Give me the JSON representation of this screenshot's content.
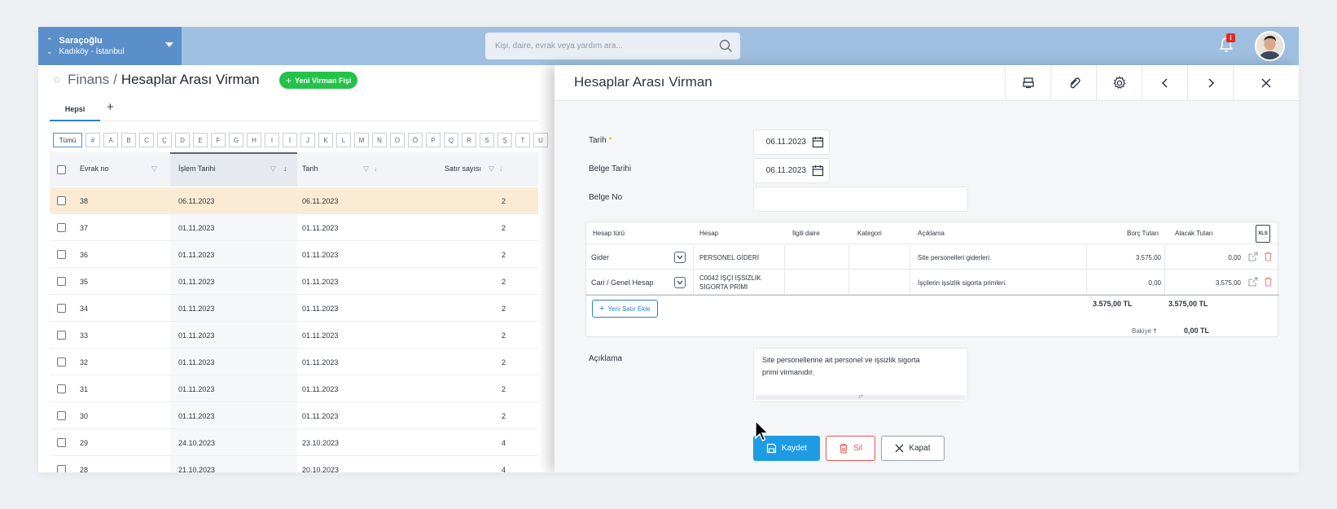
{
  "org": {
    "name": "Saraçoğlu",
    "location": "Kadıköy - İstanbul"
  },
  "search": {
    "placeholder": "Kişi, daire, evrak veya yardım ara..."
  },
  "notifications": {
    "badge": "i"
  },
  "breadcrumb": {
    "parent": "Finans",
    "separator": "/",
    "current": "Hesaplar Arası Virman"
  },
  "new_button": {
    "plus": "+",
    "label": "Yeni Virman Fişi"
  },
  "tabs": {
    "active": "Hepsi",
    "add": "+"
  },
  "letters": [
    "Tümü",
    "#",
    "A",
    "B",
    "C",
    "Ç",
    "D",
    "E",
    "F",
    "G",
    "H",
    "I",
    "İ",
    "J",
    "K",
    "L",
    "M",
    "N",
    "O",
    "Ö",
    "P",
    "Q",
    "R",
    "S",
    "Ş",
    "T",
    "U"
  ],
  "table": {
    "headers": {
      "evrak_no": "Evrak no",
      "islem_tarihi": "İşlem Tarihi",
      "tarih": "Tarih",
      "satir_sayisi": "Satır sayısı"
    },
    "rows": [
      {
        "no": "38",
        "islem": "06.11.2023",
        "tarih": "06.11.2023",
        "satir": "2",
        "selected": true
      },
      {
        "no": "37",
        "islem": "01.11.2023",
        "tarih": "01.11.2023",
        "satir": "2"
      },
      {
        "no": "36",
        "islem": "01.11.2023",
        "tarih": "01.11.2023",
        "satir": "2"
      },
      {
        "no": "35",
        "islem": "01.11.2023",
        "tarih": "01.11.2023",
        "satir": "2"
      },
      {
        "no": "34",
        "islem": "01.11.2023",
        "tarih": "01.11.2023",
        "satir": "2"
      },
      {
        "no": "33",
        "islem": "01.11.2023",
        "tarih": "01.11.2023",
        "satir": "2"
      },
      {
        "no": "32",
        "islem": "01.11.2023",
        "tarih": "01.11.2023",
        "satir": "2"
      },
      {
        "no": "31",
        "islem": "01.11.2023",
        "tarih": "01.11.2023",
        "satir": "2"
      },
      {
        "no": "30",
        "islem": "01.11.2023",
        "tarih": "01.11.2023",
        "satir": "2"
      },
      {
        "no": "29",
        "islem": "24.10.2023",
        "tarih": "23.10.2023",
        "satir": "4"
      },
      {
        "no": "28",
        "islem": "21.10.2023",
        "tarih": "20.10.2023",
        "satir": "4"
      }
    ]
  },
  "panel": {
    "title": "Hesaplar Arası Virman",
    "labels": {
      "tarih": "Tarih",
      "required": "*",
      "belge_tarihi": "Belge Tarihi",
      "belge_no": "Belge No",
      "aciklama": "Açıklama"
    },
    "values": {
      "tarih": "06.11.2023",
      "belge_tarihi": "06.11.2023",
      "belge_no": ""
    },
    "grid": {
      "headers": {
        "hesap_turu": "Hesap türü",
        "hesap": "Hesap",
        "ilgili_daire": "İlgili daire",
        "kategori": "Kategori",
        "aciklama": "Açıklama",
        "borc": "Borç Tutarı",
        "alacak": "Alacak Tutarı",
        "xls": "XLS"
      },
      "rows": [
        {
          "tur": "Gider",
          "hesap1": "PERSONEL GİDERİ",
          "hesap2": "",
          "aciklama": "Site personelleri giderleri.",
          "borc": "3.575,00",
          "alacak": "0,00"
        },
        {
          "tur": "Cari / Genel Hesap",
          "hesap1": "C0042 İŞÇİ İŞSİZLİK",
          "hesap2": "SİGORTA PRİMİ",
          "aciklama": "İşçilerin işsizlik sigorta primleri.",
          "borc": "0,00",
          "alacak": "3.575,00"
        }
      ],
      "add_row": {
        "plus": "+",
        "label": "Yeni Satır Ekle"
      },
      "total_borc": "3.575,00 TL",
      "total_alacak": "3.575,00 TL",
      "bakiye_label": "Bakiye",
      "bakiye_value": "0,00 TL"
    },
    "description": {
      "line1": "Site personellerine ait personel ve işsizlik sigorta",
      "line2": "primi virmanıdır.",
      "resize": "⇄"
    },
    "buttons": {
      "save": "Kaydet",
      "delete": "Sil",
      "close": "Kapat"
    }
  },
  "colors": {
    "topbar": "#9ebfe0",
    "org": "#5b8fc9",
    "accent_green": "#24c24a",
    "save_blue": "#1e9be3",
    "delete_red": "#e45454",
    "selected_row": "#fcebd4"
  }
}
